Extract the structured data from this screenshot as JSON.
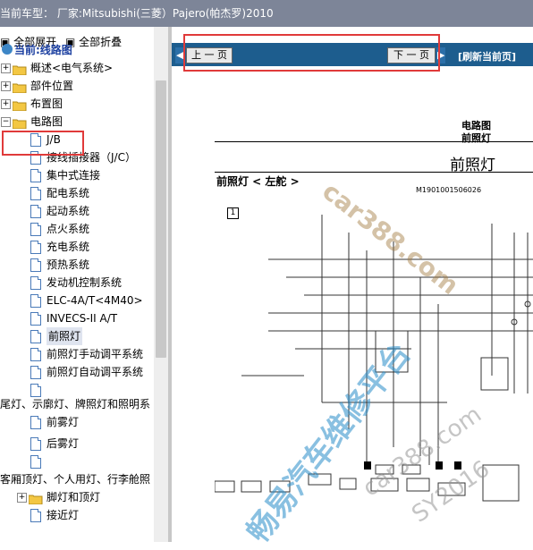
{
  "window_title": "当前车型： 厂家:Mitsubishi(三菱）Pajero(帕杰罗)2010",
  "toolbar": {
    "expand_all": "全部展开",
    "collapse_all": "全部折叠"
  },
  "tree": {
    "root_label": "当前:线路图",
    "top_items": [
      "概述<电气系统>",
      "部件位置",
      "布置图",
      "电路图"
    ],
    "children": [
      "J/B",
      "接线插接器（J/C）",
      "集中式连接",
      "配电系统",
      "起动系统",
      "点火系统",
      "充电系统",
      "预热系统",
      "发动机控制系统",
      "ELC-4A/T<4M40>",
      "INVECS-II A/T",
      "前照灯",
      "前照灯手动调平系统",
      "前照灯自动调平系统"
    ],
    "section1_label": "尾灯、示廓灯、牌照灯和照明系",
    "section1_items": [
      "前雾灯",
      "后雾灯"
    ],
    "section2_label": "客厢顶灯、个人用灯、行李舱照",
    "section2_items": [
      "脚灯和顶灯",
      "接近灯"
    ]
  },
  "nav": {
    "prev": "上 一 页",
    "next": "下 一 页",
    "refresh": "[刷新当前页]"
  },
  "document": {
    "header_line1": "电路图",
    "header_line2": "前照灯",
    "main_title": "前照灯",
    "subtitle": "前照灯 < 左舵 >",
    "code": "M1901001506026",
    "box_number": "1"
  },
  "watermarks": {
    "site1": "car388.com",
    "cn": "畅易汽车维修平台",
    "site2": "car388.com",
    "code": "SY2016"
  },
  "colors": {
    "titlebar": "#7d8598",
    "navbar": "#1d5d8e",
    "highlight": "#e03a3a",
    "tree_root": "#1b3fa0"
  }
}
